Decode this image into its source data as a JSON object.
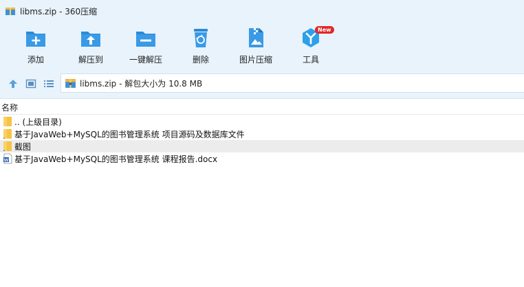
{
  "window": {
    "title": "libms.zip - 360压缩"
  },
  "toolbar": {
    "items": [
      {
        "label": "添加",
        "icon": "add-icon"
      },
      {
        "label": "解压到",
        "icon": "extract-to-icon"
      },
      {
        "label": "一键解压",
        "icon": "one-click-extract-icon"
      },
      {
        "label": "删除",
        "icon": "delete-icon"
      },
      {
        "label": "图片压缩",
        "icon": "image-compress-icon"
      },
      {
        "label": "工具",
        "icon": "tools-icon"
      }
    ],
    "tools_badge": "New"
  },
  "address": {
    "text": "libms.zip - 解包大小为 10.8 MB"
  },
  "columns": {
    "name": "名称"
  },
  "files": [
    {
      "name": ".. (上级目录)",
      "type": "folder"
    },
    {
      "name": "基于JavaWeb+MySQL的图书管理系统 项目源码及数据库文件",
      "type": "folder"
    },
    {
      "name": "截图",
      "type": "folder"
    },
    {
      "name": "基于JavaWeb+MySQL的图书管理系统 课程报告.docx",
      "type": "docx"
    }
  ],
  "colors": {
    "accent": "#2a8ad8",
    "chrome": "#e8f3fc",
    "folder": "#f6c343",
    "badge": "#e02828"
  }
}
